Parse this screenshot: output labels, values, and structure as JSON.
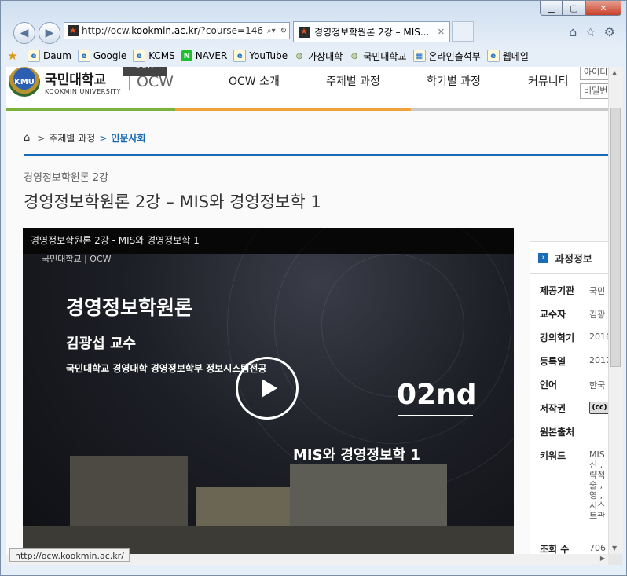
{
  "browser": {
    "address_host": "http://ocw.",
    "address_domain": "kookmin.ac.kr",
    "address_rest": "/?course=146",
    "tab_title": "경영정보학원론 2강 – MIS...",
    "status_url": "http://ocw.kookmin.ac.kr/",
    "window_buttons": {
      "minimize": "▁",
      "maximize": "▢",
      "close": "✕"
    }
  },
  "favorites": [
    {
      "label": "Daum",
      "icon": "ie-icon"
    },
    {
      "label": "Google",
      "icon": "ie-icon"
    },
    {
      "label": "KCMS",
      "icon": "ie-icon"
    },
    {
      "label": "NAVER",
      "icon": "naver-icon"
    },
    {
      "label": "YouTube",
      "icon": "ie-icon"
    },
    {
      "label": "가상대학",
      "icon": "globe-icon"
    },
    {
      "label": "국민대학교",
      "icon": "globe-icon"
    },
    {
      "label": "온라인출석부",
      "icon": "grid-icon"
    },
    {
      "label": "웹메일",
      "icon": "ie-icon"
    }
  ],
  "site": {
    "logo_badge": "KMU",
    "logo_ko": "국민대학교",
    "logo_en": "KOOKMIN UNIVERSITY",
    "ocw": "OCW",
    "tooltip": "OCW",
    "nav": [
      "OCW 소개",
      "주제별 과정",
      "학기별 과정",
      "커뮤니티"
    ],
    "login_id_placeholder": "아이디",
    "login_pw_placeholder": "비밀번호",
    "colors": {
      "blue": "#1b6cb6",
      "green": "#7ab23c",
      "orange": "#f0a23a",
      "gray": "#c9c9c9"
    }
  },
  "breadcrumb": {
    "items": [
      "주제별 과정",
      "인문사회"
    ]
  },
  "lecture": {
    "subtitle": "경영정보학원론 2강",
    "title": "경영정보학원론 2강 – MIS와 경영정보학 1"
  },
  "video": {
    "top_title": "경영정보학원론 2강 - MIS와 경영정보학 1",
    "logo_text": "국민대학교 | OCW",
    "course": "경영정보학원론",
    "professor": "김광섭 교수",
    "department": "국민대학교 경영대학 경영정보학부 정보시스템전공",
    "number": "02nd",
    "topic": "MIS와 경영정보학 1"
  },
  "panel": {
    "title": "과정정보",
    "rows": [
      {
        "label": "제공기관",
        "value": "국민"
      },
      {
        "label": "교수자",
        "value": "김광"
      },
      {
        "label": "강의학기",
        "value": "2016"
      },
      {
        "label": "등록일",
        "value": "2017"
      },
      {
        "label": "언어",
        "value": "한국"
      },
      {
        "label": "저작권",
        "value": "(cc)"
      },
      {
        "label": "원본출처",
        "value": ""
      },
      {
        "label": "키워드",
        "value": "MIS\n신 ,\n략적\n술 ,\n영 ,\n시스\n트관"
      },
      {
        "label": "조회 수",
        "value": "706"
      }
    ]
  }
}
